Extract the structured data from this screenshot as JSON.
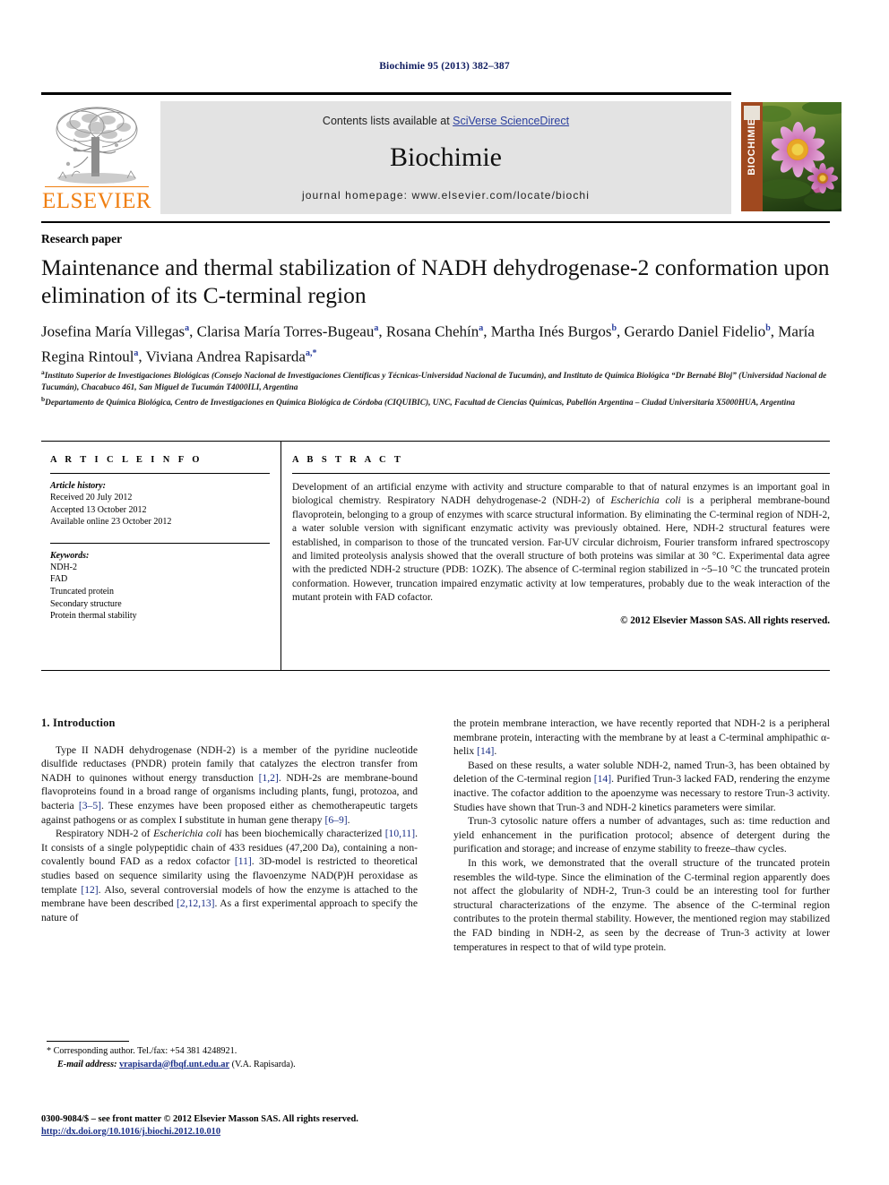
{
  "running_head": "Biochimie 95 (2013) 382–387",
  "masthead": {
    "publisher": "ELSEVIER",
    "contents_prefix": "Contents lists available at ",
    "contents_link": "SciVerse ScienceDirect",
    "journal_title": "Biochimie",
    "homepage": "journal homepage: www.elsevier.com/locate/biochi",
    "cover_spine_label": "BIOCHIMIE"
  },
  "article": {
    "section_type": "Research paper",
    "title": "Maintenance and thermal stabilization of NADH dehydrogenase-2 conformation upon elimination of its C-terminal region",
    "authors_line1": "Josefina María Villegas",
    "authors": "Josefina María Villegas a, Clarisa María Torres-Bugeau a, Rosana Chehín a, Martha Inés Burgos b, Gerardo Daniel Fidelio b, María Regina Rintoul a, Viviana Andrea Rapisarda a,*",
    "affiliation_a": "Instituto Superior de Investigaciones Biológicas (Consejo Nacional de Investigaciones Científicas y Técnicas-Universidad Nacional de Tucumán), and Instituto de Química Biológica “Dr Bernabé Bloj” (Universidad Nacional de Tucumán), Chacabuco 461, San Miguel de Tucumán T4000ILI, Argentina",
    "affiliation_b": "Departamento de Química Biológica, Centro de Investigaciones en Química Biológica de Córdoba (CIQUIBIC), UNC, Facultad de Ciencias Químicas, Pabellón Argentina – Ciudad Universitaria X5000HUA, Argentina"
  },
  "info": {
    "heading": "A R T I C L E   I N F O",
    "history_label": "Article history:",
    "history": [
      "Received 20 July 2012",
      "Accepted 13 October 2012",
      "Available online 23 October 2012"
    ],
    "keywords_label": "Keywords:",
    "keywords": [
      "NDH-2",
      "FAD",
      "Truncated protein",
      "Secondary structure",
      "Protein thermal stability"
    ]
  },
  "abstract": {
    "heading": "A B S T R A C T",
    "p1_a": "Development of an artificial enzyme with activity and structure comparable to that of natural enzymes is an important goal in biological chemistry. Respiratory NADH dehydrogenase-2 (NDH-2) of ",
    "p1_italic1": "Escherichia coli",
    "p1_b": " is a peripheral membrane-bound flavoprotein, belonging to a group of enzymes with scarce structural information. By eliminating the C-terminal region of NDH-2, a water soluble version with significant enzymatic activity was previously obtained. Here, NDH-2 structural features were established, in comparison to those of the truncated version. Far-UV circular dichroism, Fourier transform infrared spectroscopy and limited proteolysis analysis showed that the overall structure of both proteins was similar at 30 °C. Experimental data agree with the predicted NDH-2 structure (PDB: 1OZK). The absence of C-terminal region stabilized in ~5–10 °C the truncated protein conformation. However, truncation impaired enzymatic activity at low temperatures, probably due to the weak interaction of the mutant protein with FAD cofactor.",
    "copyright": "© 2012 Elsevier Masson SAS. All rights reserved."
  },
  "body": {
    "intro_heading": "1. Introduction",
    "left_p1_a": "Type II NADH dehydrogenase (NDH-2) is a member of the pyridine nucleotide disulfide reductases (PNDR) protein family that catalyzes the electron transfer from NADH to quinones without energy transduction ",
    "left_p1_c1": "[1,2]",
    "left_p1_b": ". NDH-2s are membrane-bound flavoproteins found in a broad range of organisms including plants, fungi, protozoa, and bacteria ",
    "left_p1_c2": "[3–5]",
    "left_p1_c": ". These enzymes have been proposed either as chemotherapeutic targets against pathogens or as complex I substitute in human gene therapy ",
    "left_p1_c3": "[6–9]",
    "left_p1_d": ".",
    "left_p2_a": "Respiratory NDH-2 of ",
    "left_p2_i1": "Escherichia coli",
    "left_p2_b": " has been biochemically characterized ",
    "left_p2_c1": "[10,11]",
    "left_p2_c": ". It consists of a single polypeptidic chain of 433 residues (47,200 Da), containing a non-covalently bound FAD as a redox cofactor ",
    "left_p2_c2": "[11]",
    "left_p2_d": ". 3D-model is restricted to theoretical studies based on sequence similarity using the flavoenzyme NAD(P)H peroxidase as template ",
    "left_p2_c3": "[12]",
    "left_p2_e": ". Also, several controversial models of how the enzyme is attached to the membrane have been described ",
    "left_p2_c4": "[2,12,13]",
    "left_p2_f": ". As a first experimental approach to specify the nature of",
    "right_p1_a": "the protein membrane interaction, we have recently reported that NDH-2 is a peripheral membrane protein, interacting with the membrane by at least a C-terminal amphipathic α-helix ",
    "right_p1_c1": "[14]",
    "right_p1_b": ".",
    "right_p2_a": "Based on these results, a water soluble NDH-2, named Trun-3, has been obtained by deletion of the C-terminal region ",
    "right_p2_c1": "[14]",
    "right_p2_b": ". Purified Trun-3 lacked FAD, rendering the enzyme inactive. The cofactor addition to the apoenzyme was necessary to restore Trun-3 activity. Studies have shown that Trun-3 and NDH-2 kinetics parameters were similar.",
    "right_p3": "Trun-3 cytosolic nature offers a number of advantages, such as: time reduction and yield enhancement in the purification protocol; absence of detergent during the purification and storage; and increase of enzyme stability to freeze–thaw cycles.",
    "right_p4": "In this work, we demonstrated that the overall structure of the truncated protein resembles the wild-type. Since the elimination of the C-terminal region apparently does not affect the globularity of NDH-2, Trun-3 could be an interesting tool for further structural characterizations of the enzyme. The absence of the C-terminal region contributes to the protein thermal stability. However, the mentioned region may stabilized the FAD binding in NDH-2, as seen by the decrease of Trun-3 activity at lower temperatures in respect to that of wild type protein."
  },
  "footnote": {
    "corresponding": "* Corresponding author. Tel./fax: +54 381 4248921.",
    "email_label": "E-mail address:",
    "email": "vrapisarda@fbqf.unt.edu.ar",
    "email_suffix": " (V.A. Rapisarda)."
  },
  "imprint": {
    "line1": "0300-9084/$ – see front matter © 2012 Elsevier Masson SAS. All rights reserved.",
    "doi": "http://dx.doi.org/10.1016/j.biochi.2012.10.010"
  },
  "colors": {
    "elsevier_orange": "#F07F11",
    "link_blue": "#2b3f9e",
    "cite_blue": "#1a2f87",
    "running_head": "#0d1a5e",
    "banner_gray": "#e3e3e3",
    "cover_spine": "#a0491f"
  }
}
